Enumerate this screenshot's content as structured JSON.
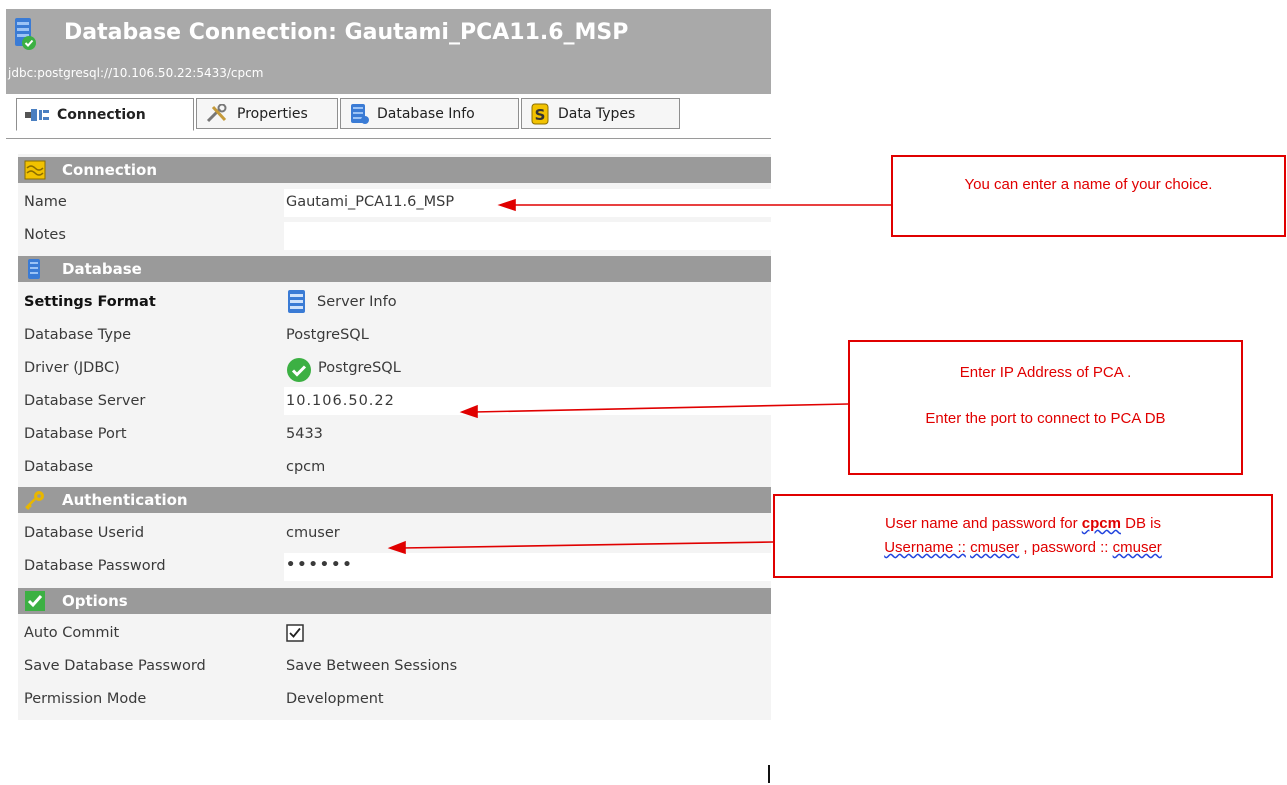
{
  "window": {
    "title": "Database Connection: Gautami_PCA11.6_MSP",
    "subtitle": "jdbc:postgresql://10.106.50.22:5433/cpcm"
  },
  "tabs": [
    {
      "label": "Connection",
      "icon": "plug-icon",
      "active": true
    },
    {
      "label": "Properties",
      "icon": "tools-icon",
      "active": false
    },
    {
      "label": "Database Info",
      "icon": "database-icon",
      "active": false
    },
    {
      "label": "Data Types",
      "icon": "dollar-icon",
      "active": false
    }
  ],
  "sections": {
    "connection": {
      "title": "Connection",
      "name_label": "Name",
      "name_value": "Gautami_PCA11.6_MSP",
      "notes_label": "Notes",
      "notes_value": ""
    },
    "database": {
      "title": "Database",
      "settings_format_label": "Settings Format",
      "settings_format_value": "Server Info",
      "db_type_label": "Database Type",
      "db_type_value": "PostgreSQL",
      "driver_label": "Driver (JDBC)",
      "driver_value": "PostgreSQL",
      "server_label": "Database Server",
      "server_value": "10.106.50.22",
      "port_label": "Database Port",
      "port_value": "5433",
      "database_label": "Database",
      "database_value": "cpcm"
    },
    "authentication": {
      "title": "Authentication",
      "userid_label": "Database Userid",
      "userid_value": "cmuser",
      "password_label": "Database Password",
      "password_value": "••••••"
    },
    "options": {
      "title": "Options",
      "auto_commit_label": "Auto Commit",
      "auto_commit_checked": true,
      "save_password_label": "Save Database Password",
      "save_password_value": "Save Between Sessions",
      "permission_label": "Permission Mode",
      "permission_value": "Development"
    }
  },
  "callouts": {
    "name_note": "You can enter a name of your choice.",
    "server_note_line1": "Enter IP Address of PCA .",
    "server_note_line2": "Enter the port to connect to PCA DB",
    "auth_note_prefix": "User name and password for ",
    "auth_note_db": "cpcm",
    "auth_note_suffix": " DB is",
    "auth_note_line2_a": "Username ::",
    "auth_note_line2_b": " ",
    "auth_note_line2_c": "cmuser",
    "auth_note_line2_d": " , password :: ",
    "auth_note_line2_e": "cmuser"
  },
  "colors": {
    "header_gray": "#a9a9a9",
    "section_gray": "#9a9a9a",
    "annotation_red": "#e00000"
  }
}
